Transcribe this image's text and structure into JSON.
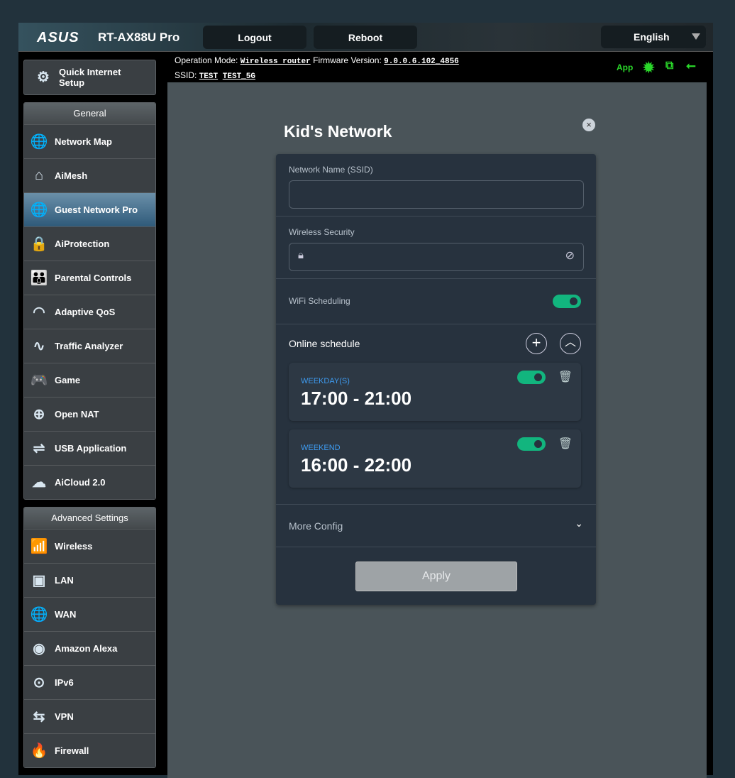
{
  "header": {
    "brand": "ASUS",
    "model": "RT-AX88U Pro",
    "logout": "Logout",
    "reboot": "Reboot",
    "language": "English"
  },
  "info": {
    "op_mode_label": "Operation Mode:",
    "op_mode": "Wireless router",
    "fw_label": "Firmware Version:",
    "fw": "9.0.0.6.102_4856",
    "ssid_label": "SSID:",
    "ssid1": "TEST",
    "ssid2": "TEST_5G",
    "app": "App"
  },
  "sidebar": {
    "quick": "Quick Internet Setup",
    "general": "General",
    "general_items": [
      {
        "label": "Network Map",
        "icon": "🌐"
      },
      {
        "label": "AiMesh",
        "icon": "⌂"
      },
      {
        "label": "Guest Network Pro",
        "icon": "🌐"
      },
      {
        "label": "AiProtection",
        "icon": "🔒"
      },
      {
        "label": "Parental Controls",
        "icon": "👪"
      },
      {
        "label": "Adaptive QoS",
        "icon": "◠"
      },
      {
        "label": "Traffic Analyzer",
        "icon": "∿"
      },
      {
        "label": "Game",
        "icon": "🎮"
      },
      {
        "label": "Open NAT",
        "icon": "⊕"
      },
      {
        "label": "USB Application",
        "icon": "⇌"
      },
      {
        "label": "AiCloud 2.0",
        "icon": "☁"
      }
    ],
    "advanced": "Advanced Settings",
    "advanced_items": [
      {
        "label": "Wireless",
        "icon": "📶"
      },
      {
        "label": "LAN",
        "icon": "▣"
      },
      {
        "label": "WAN",
        "icon": "🌐"
      },
      {
        "label": "Amazon Alexa",
        "icon": "◉"
      },
      {
        "label": "IPv6",
        "icon": "⊙"
      },
      {
        "label": "VPN",
        "icon": "⇆"
      },
      {
        "label": "Firewall",
        "icon": "🔥"
      }
    ]
  },
  "modal": {
    "title": "Kid's Network",
    "ssid_label": "Network Name (SSID)",
    "ssid_value": "",
    "security_label": "Wireless Security",
    "security_value": "",
    "scheduling_label": "WiFi Scheduling",
    "scheduling_on": true,
    "schedule_label": "Online schedule",
    "schedules": [
      {
        "days": "WEEKDAY(S)",
        "time": "17:00 - 21:00",
        "enabled": true
      },
      {
        "days": "WEEKEND",
        "time": "16:00 - 22:00",
        "enabled": true
      }
    ],
    "more_config": "More Config",
    "apply": "Apply"
  },
  "colors": {
    "accent_green": "#12b57e",
    "day_blue": "#3e9bf0",
    "status_green": "#2ad72a"
  }
}
